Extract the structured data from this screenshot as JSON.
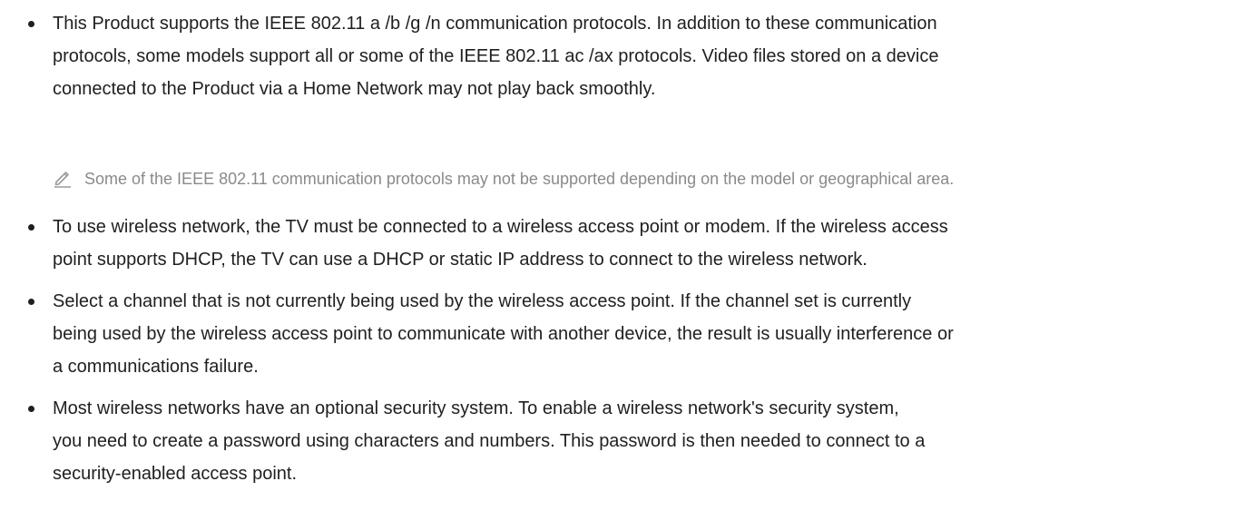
{
  "bullets": [
    {
      "lines": [
        "This Product supports the IEEE 802.11 a /b /g /n communication protocols. In addition to these communication",
        "protocols, some models support all or some of the IEEE 802.11 ac /ax protocols. Video files stored on a device",
        "connected to the Product via a Home Network may not play back smoothly."
      ]
    },
    {
      "lines": [
        "To use wireless network, the TV must be connected to a wireless access point or modem. If the wireless access",
        "point supports DHCP, the TV can use a DHCP or static IP address to connect to the wireless network."
      ]
    },
    {
      "lines": [
        "Select a channel that is not currently being used by the wireless access point. If the channel set is currently",
        "being used by the wireless access point to communicate with another device, the result is usually interference or",
        "a communications failure."
      ]
    },
    {
      "lines": [
        "Most wireless networks have an optional security system. To enable a wireless network's security system,",
        "you need to create a password using characters and numbers. This password is then needed to connect to a",
        "security-enabled access point."
      ]
    }
  ],
  "note": {
    "icon": "pencil-icon",
    "text": "Some of the IEEE 802.11 communication protocols may not be supported depending on the model or geographical area."
  },
  "colors": {
    "body_text": "#1f1f1f",
    "note_text": "#8a8a8a"
  }
}
